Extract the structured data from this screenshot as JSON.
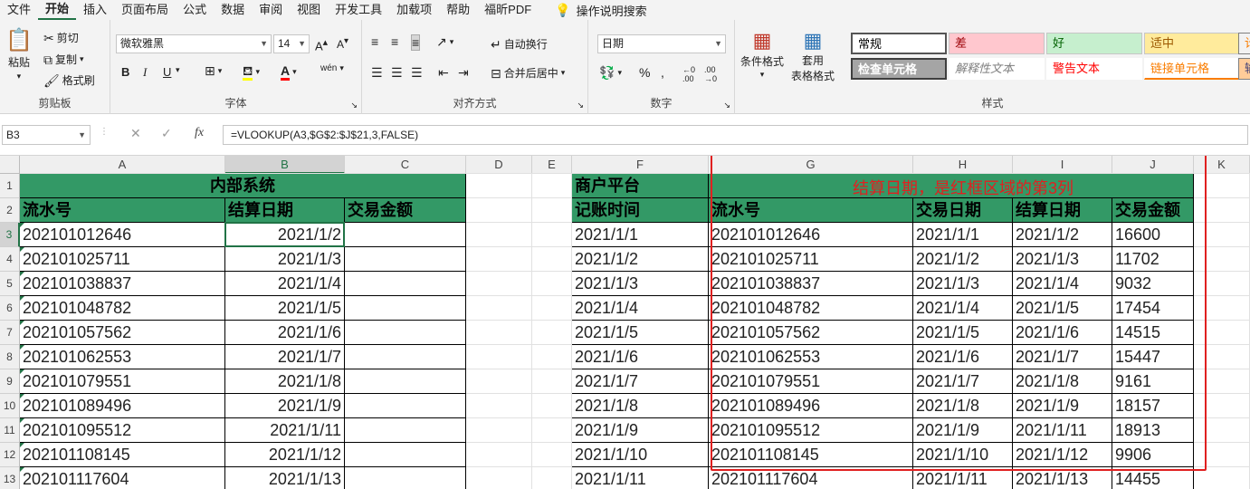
{
  "menu": {
    "items": [
      "文件",
      "开始",
      "插入",
      "页面布局",
      "公式",
      "数据",
      "审阅",
      "视图",
      "开发工具",
      "加载项",
      "帮助",
      "福昕PDF"
    ],
    "active_index": 1,
    "tell_me": "操作说明搜索",
    "tell_icon": "lightbulb-icon"
  },
  "ribbon": {
    "clipboard": {
      "paste": "粘贴",
      "cut": "剪切",
      "copy": "复制",
      "format_painter": "格式刷",
      "label": "剪贴板"
    },
    "font": {
      "name": "微软雅黑",
      "size": "14",
      "bold": "B",
      "italic": "I",
      "underline": "U",
      "font_color_glyph": "A",
      "phonetic": "wén",
      "label": "字体"
    },
    "alignment": {
      "wrap": "自动换行",
      "merge": "合并后居中",
      "label": "对齐方式"
    },
    "number": {
      "format": "日期",
      "label": "数字"
    },
    "styles": {
      "conditional": "条件格式",
      "table_fmt_1": "套用",
      "table_fmt_2": "表格格式",
      "cells": [
        {
          "text": "常规",
          "bg": "#ffffff",
          "fg": "#000000"
        },
        {
          "text": "差",
          "bg": "#ffc7ce",
          "fg": "#9c0006"
        },
        {
          "text": "好",
          "bg": "#c6efce",
          "fg": "#006100"
        },
        {
          "text": "适中",
          "bg": "#ffeb9c",
          "fg": "#9c5700"
        },
        {
          "text": "计",
          "bg": "#f2f2f2",
          "fg": "#fa7d00"
        },
        {
          "text": "检查单元格",
          "bg": "#a5a5a5",
          "fg": "#ffffff"
        },
        {
          "text": "解释性文本",
          "bg": "#ffffff",
          "fg": "#7f7f7f"
        },
        {
          "text": "警告文本",
          "bg": "#ffffff",
          "fg": "#ff0000"
        },
        {
          "text": "链接单元格",
          "bg": "#ffffff",
          "fg": "#fa7d00"
        },
        {
          "text": "输",
          "bg": "#ffcc99",
          "fg": "#3f3f76"
        }
      ],
      "label": "样式"
    }
  },
  "formula_bar": {
    "name_box": "B3",
    "cancel": "✕",
    "enter": "✓",
    "fx": "fx",
    "formula": "=VLOOKUP(A3,$G$2:$J$21,3,FALSE)"
  },
  "sheet": {
    "columns": [
      "A",
      "B",
      "C",
      "D",
      "E",
      "F",
      "G",
      "H",
      "I",
      "J",
      "K"
    ],
    "rows": [
      "1",
      "2",
      "3",
      "4",
      "5",
      "6",
      "7",
      "8",
      "9",
      "10",
      "11",
      "12",
      "13"
    ],
    "left_title": "内部系统",
    "left_headers": [
      "流水号",
      "结算日期",
      "交易金额"
    ],
    "right_title": "商户平台",
    "right_headers": [
      "记账时间",
      "流水号",
      "交易日期",
      "结算日期",
      "交易金额"
    ],
    "annotation": "结算日期，是红框区域的第3列",
    "left_rows": [
      [
        "202101012646",
        "2021/1/2",
        ""
      ],
      [
        "202101025711",
        "2021/1/3",
        ""
      ],
      [
        "202101038837",
        "2021/1/4",
        ""
      ],
      [
        "202101048782",
        "2021/1/5",
        ""
      ],
      [
        "202101057562",
        "2021/1/6",
        ""
      ],
      [
        "202101062553",
        "2021/1/7",
        ""
      ],
      [
        "202101079551",
        "2021/1/8",
        ""
      ],
      [
        "202101089496",
        "2021/1/9",
        ""
      ],
      [
        "202101095512",
        "2021/1/11",
        ""
      ],
      [
        "202101108145",
        "2021/1/12",
        ""
      ],
      [
        "202101117604",
        "2021/1/13",
        ""
      ]
    ],
    "right_rows": [
      [
        "2021/1/1",
        "202101012646",
        "2021/1/1",
        "2021/1/2",
        "16600"
      ],
      [
        "2021/1/2",
        "202101025711",
        "2021/1/2",
        "2021/1/3",
        "11702"
      ],
      [
        "2021/1/3",
        "202101038837",
        "2021/1/3",
        "2021/1/4",
        "9032"
      ],
      [
        "2021/1/4",
        "202101048782",
        "2021/1/4",
        "2021/1/5",
        "17454"
      ],
      [
        "2021/1/5",
        "202101057562",
        "2021/1/5",
        "2021/1/6",
        "14515"
      ],
      [
        "2021/1/6",
        "202101062553",
        "2021/1/6",
        "2021/1/7",
        "15447"
      ],
      [
        "2021/1/7",
        "202101079551",
        "2021/1/7",
        "2021/1/8",
        "9161"
      ],
      [
        "2021/1/8",
        "202101089496",
        "2021/1/8",
        "2021/1/9",
        "18157"
      ],
      [
        "2021/1/9",
        "202101095512",
        "2021/1/9",
        "2021/1/11",
        "18913"
      ],
      [
        "2021/1/10",
        "202101108145",
        "2021/1/10",
        "2021/1/12",
        "9906"
      ],
      [
        "2021/1/11",
        "202101117604",
        "2021/1/11",
        "2021/1/13",
        "14455"
      ]
    ]
  },
  "colors": {
    "accent": "#217346",
    "header_fill": "#339966",
    "annotation": "#e02020"
  }
}
